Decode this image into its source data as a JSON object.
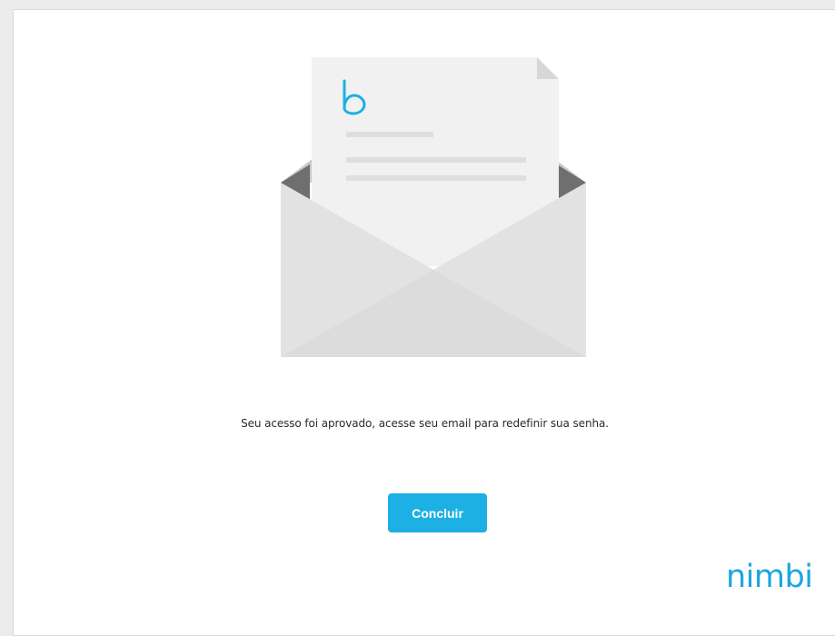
{
  "illustration": {
    "name": "open-envelope-letter",
    "letter_logo_glyph": "b",
    "brand_color": "#1cb0e4"
  },
  "message": {
    "text": "Seu acesso foi aprovado, acesse seu email para redefinir sua senha."
  },
  "actions": {
    "finish_label": "Concluir"
  },
  "footer": {
    "brand": "nimbi"
  },
  "colors": {
    "accent": "#1cb0e4",
    "text": "#2b2b2b",
    "background": "#ffffff"
  }
}
